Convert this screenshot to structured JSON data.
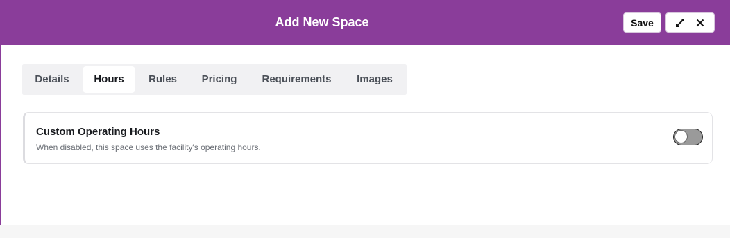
{
  "header": {
    "title": "Add New Space",
    "save_label": "Save",
    "expand_icon": "expand-icon",
    "close_icon": "close-icon",
    "brand_color": "#8a3d9a"
  },
  "tabs": [
    {
      "label": "Details",
      "active": false
    },
    {
      "label": "Hours",
      "active": true
    },
    {
      "label": "Rules",
      "active": false
    },
    {
      "label": "Pricing",
      "active": false
    },
    {
      "label": "Requirements",
      "active": false
    },
    {
      "label": "Images",
      "active": false
    }
  ],
  "hours": {
    "title": "Custom Operating Hours",
    "description": "When disabled, this space uses the facility's operating hours.",
    "enabled": false
  }
}
